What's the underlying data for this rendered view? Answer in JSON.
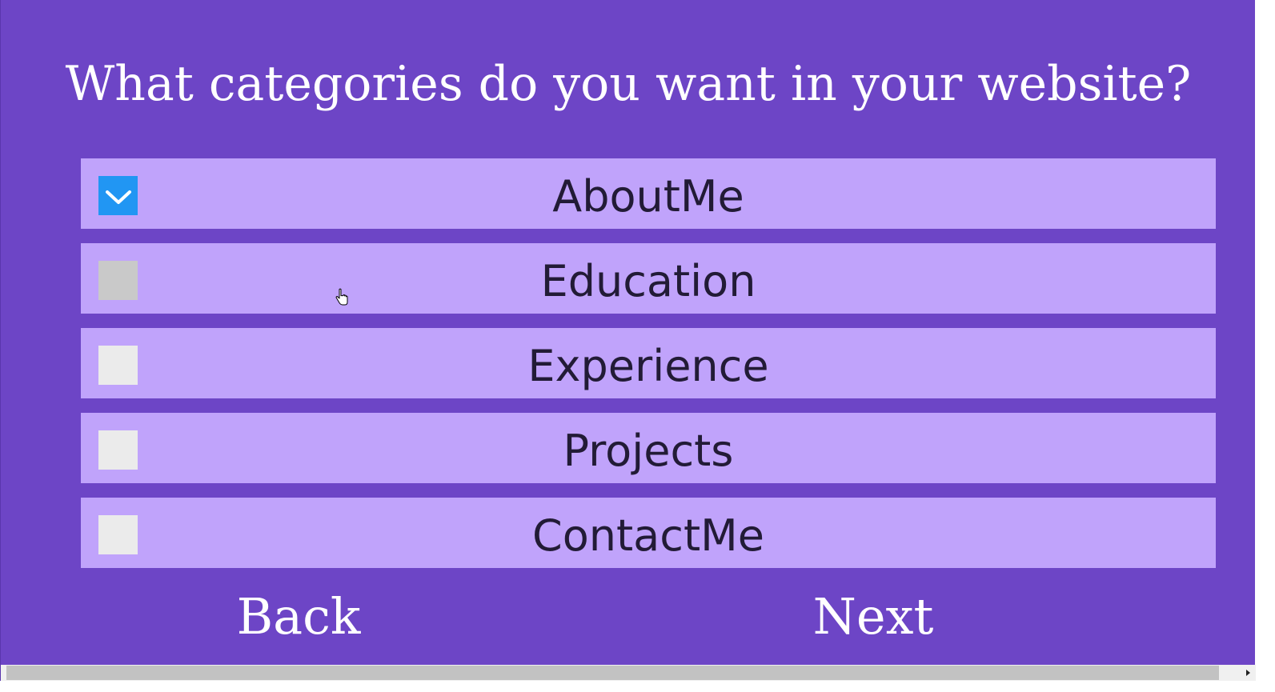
{
  "page": {
    "title": "What categories do you want in your website?"
  },
  "categories": [
    {
      "label": "AboutMe",
      "checked": true
    },
    {
      "label": "Education",
      "checked": false
    },
    {
      "label": "Experience",
      "checked": false
    },
    {
      "label": "Projects",
      "checked": false
    },
    {
      "label": "ContactMe",
      "checked": false
    }
  ],
  "nav": {
    "back_label": "Back",
    "next_label": "Next"
  },
  "icons": {
    "checkmark": "checkmark-icon",
    "cursor": "hand-cursor-icon",
    "scroll_right": "chevron-right-icon"
  },
  "colors": {
    "background": "#6d45c6",
    "row": "#c0a3fb",
    "checkbox_checked": "#2196f3",
    "checkbox_unchecked": "#ebebeb",
    "checkbox_hover": "#c9c9c9"
  }
}
